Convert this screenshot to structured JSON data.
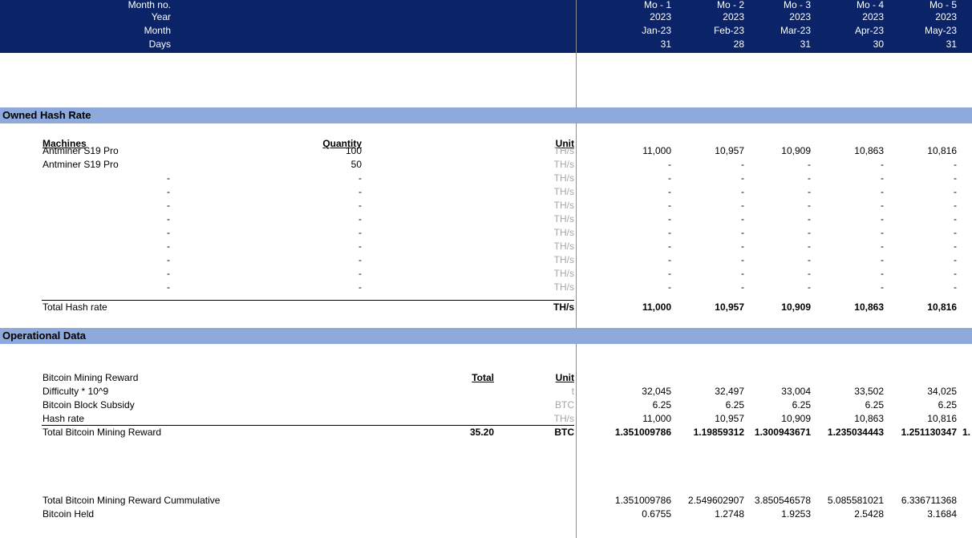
{
  "header": {
    "row_labels": [
      "Month no.",
      "Year",
      "Month",
      "Days"
    ],
    "columns": [
      {
        "month_no": "Mo - 1",
        "year": "2023",
        "month": "Jan-23",
        "days": "31"
      },
      {
        "month_no": "Mo - 2",
        "year": "2023",
        "month": "Feb-23",
        "days": "28"
      },
      {
        "month_no": "Mo - 3",
        "year": "2023",
        "month": "Mar-23",
        "days": "31"
      },
      {
        "month_no": "Mo - 4",
        "year": "2023",
        "month": "Apr-23",
        "days": "30"
      },
      {
        "month_no": "Mo - 5",
        "year": "2023",
        "month": "May-23",
        "days": "31"
      }
    ]
  },
  "owned_hash_rate": {
    "title": "Owned Hash Rate",
    "machines_header": "Machines",
    "quantity_header": "Quantity",
    "unit_header": "Unit",
    "machines": [
      {
        "name": "Antminer S19 Pro",
        "quantity": "100",
        "unit": "TH/s",
        "values": [
          "11,000",
          "10,957",
          "10,909",
          "10,863",
          "10,816"
        ]
      },
      {
        "name": "Antminer S19 Pro",
        "quantity": "50",
        "unit": "TH/s",
        "values": [
          "-",
          "-",
          "-",
          "-",
          "-"
        ]
      },
      {
        "name": "-",
        "quantity": "-",
        "unit": "TH/s",
        "values": [
          "-",
          "-",
          "-",
          "-",
          "-"
        ]
      },
      {
        "name": "-",
        "quantity": "-",
        "unit": "TH/s",
        "values": [
          "-",
          "-",
          "-",
          "-",
          "-"
        ]
      },
      {
        "name": "-",
        "quantity": "-",
        "unit": "TH/s",
        "values": [
          "-",
          "-",
          "-",
          "-",
          "-"
        ]
      },
      {
        "name": "-",
        "quantity": "-",
        "unit": "TH/s",
        "values": [
          "-",
          "-",
          "-",
          "-",
          "-"
        ]
      },
      {
        "name": "-",
        "quantity": "-",
        "unit": "TH/s",
        "values": [
          "-",
          "-",
          "-",
          "-",
          "-"
        ]
      },
      {
        "name": "-",
        "quantity": "-",
        "unit": "TH/s",
        "values": [
          "-",
          "-",
          "-",
          "-",
          "-"
        ]
      },
      {
        "name": "-",
        "quantity": "-",
        "unit": "TH/s",
        "values": [
          "-",
          "-",
          "-",
          "-",
          "-"
        ]
      },
      {
        "name": "-",
        "quantity": "-",
        "unit": "TH/s",
        "values": [
          "-",
          "-",
          "-",
          "-",
          "-"
        ]
      },
      {
        "name": "-",
        "quantity": "-",
        "unit": "TH/s",
        "values": [
          "-",
          "-",
          "-",
          "-",
          "-"
        ]
      }
    ],
    "total_label": "Total Hash rate",
    "total_unit": "TH/s",
    "total_values": [
      "11,000",
      "10,957",
      "10,909",
      "10,863",
      "10,816"
    ]
  },
  "operational_data": {
    "title": "Operational Data",
    "section_label": "Bitcoin Mining Reward",
    "total_header": "Total",
    "unit_header": "Unit",
    "rows": [
      {
        "label": "Difficulty * 10^9",
        "unit": "t",
        "values": [
          "32,045",
          "32,497",
          "33,004",
          "33,502",
          "34,025"
        ]
      },
      {
        "label": "Bitcoin Block Subsidy",
        "unit": "BTC",
        "values": [
          "6.25",
          "6.25",
          "6.25",
          "6.25",
          "6.25"
        ]
      },
      {
        "label": "Hash rate",
        "unit": "TH/s",
        "values": [
          "11,000",
          "10,957",
          "10,909",
          "10,863",
          "10,816"
        ]
      }
    ],
    "total_label": "Total Bitcoin Mining Reward",
    "total_value": "35.20",
    "total_unit": "BTC",
    "total_values": [
      "1.351009786",
      "1.19859312",
      "1.300943671",
      "1.235034443",
      "1.251130347"
    ],
    "total_overflow": "1.",
    "cumulative_label": "Total Bitcoin Mining Reward Cummulative",
    "cumulative_values": [
      "1.351009786",
      "2.549602907",
      "3.850546578",
      "5.085581021",
      "6.336711368"
    ],
    "held_label": "Bitcoin Held",
    "held_values": [
      "0.6755",
      "1.2748",
      "1.9253",
      "2.5428",
      "3.1684"
    ]
  }
}
